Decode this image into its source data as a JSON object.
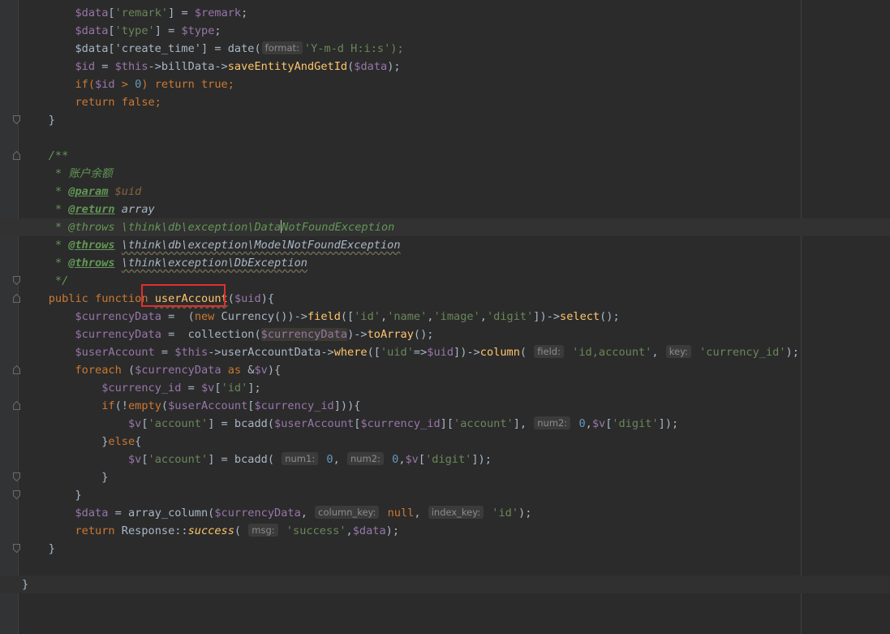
{
  "editor": {
    "language": "php",
    "lines": [
      {
        "k": "l0",
        "t": "        $data['remark'] = $remark;"
      },
      {
        "k": "l1",
        "t": "        $data['type'] = $type;"
      },
      {
        "k": "l2a",
        "t": "        $data['create_time'] = date("
      },
      {
        "k": "l2h",
        "t": "format:"
      },
      {
        "k": "l2b",
        "t": "'Y-m-d H:i:s');"
      },
      {
        "k": "l3",
        "t": "        $id = $this->billData->saveEntityAndGetId($data);"
      },
      {
        "k": "l4",
        "t": "        if($id > 0) return true;"
      },
      {
        "k": "l5",
        "t": "        return false;"
      },
      {
        "k": "l6",
        "t": "    }"
      },
      {
        "k": "l8",
        "t": "    /**"
      },
      {
        "k": "l9",
        "t": "     * 账户余额"
      },
      {
        "k": "l10",
        "t": "     * @param $uid"
      },
      {
        "k": "l11",
        "t": "     * @return array"
      },
      {
        "k": "l12",
        "t": "     * @throws \\think\\db\\exception\\DataNotFoundException"
      },
      {
        "k": "l13",
        "t": "     * @throws \\think\\db\\exception\\ModelNotFoundException"
      },
      {
        "k": "l14",
        "t": "     * @throws \\think\\exception\\DbException"
      },
      {
        "k": "l15",
        "t": "     */"
      },
      {
        "k": "l16",
        "t": "    public function userAccount($uid){"
      },
      {
        "k": "l17",
        "t": "        $currencyData =  (new Currency())->field(['id','name','image','digit'])->select();"
      },
      {
        "k": "l18",
        "t": "        $currencyData =  collection($currencyData)->toArray();"
      },
      {
        "k": "l19",
        "t": "        $userAccount = $this->userAccountData->where(['uid'=>$uid])->column( field: 'id,account', key: 'currency_id');"
      },
      {
        "k": "l20",
        "t": "        foreach ($currencyData as &$v){"
      },
      {
        "k": "l21",
        "t": "            $currency_id = $v['id'];"
      },
      {
        "k": "l22",
        "t": "            if(!empty($userAccount[$currency_id])){"
      },
      {
        "k": "l23",
        "t": "                $v['account'] = bcadd($userAccount[$currency_id]['account'], num2: 0,$v['digit']);"
      },
      {
        "k": "l24",
        "t": "            }else{"
      },
      {
        "k": "l25",
        "t": "                $v['account'] = bcadd( num1: 0, num2: 0,$v['digit']);"
      },
      {
        "k": "l26",
        "t": "            }"
      },
      {
        "k": "l27",
        "t": "        }"
      },
      {
        "k": "l28",
        "t": "        $data = array_column($currencyData, column_key: null, index_key: 'id');"
      },
      {
        "k": "l29",
        "t": "        return Response::success( msg: 'success',$data);"
      },
      {
        "k": "l30",
        "t": "    }"
      },
      {
        "k": "l32",
        "t": "}"
      }
    ],
    "hints": {
      "format": "format:",
      "field": "field:",
      "key": "key:",
      "num1": "num1:",
      "num2": "num2:",
      "column_key": "column_key:",
      "index_key": "index_key:",
      "msg": "msg:"
    },
    "highlighted_function": "userAccount",
    "colors": {
      "background": "#2b2b2b",
      "keyword": "#cc7832",
      "variable": "#9876aa",
      "string": "#6a8759",
      "function": "#ffc66d",
      "number": "#6897bb",
      "doc_comment": "#629755",
      "annotation_box": "#e02f2f"
    },
    "icons": [
      "fold-marker-icon"
    ]
  }
}
